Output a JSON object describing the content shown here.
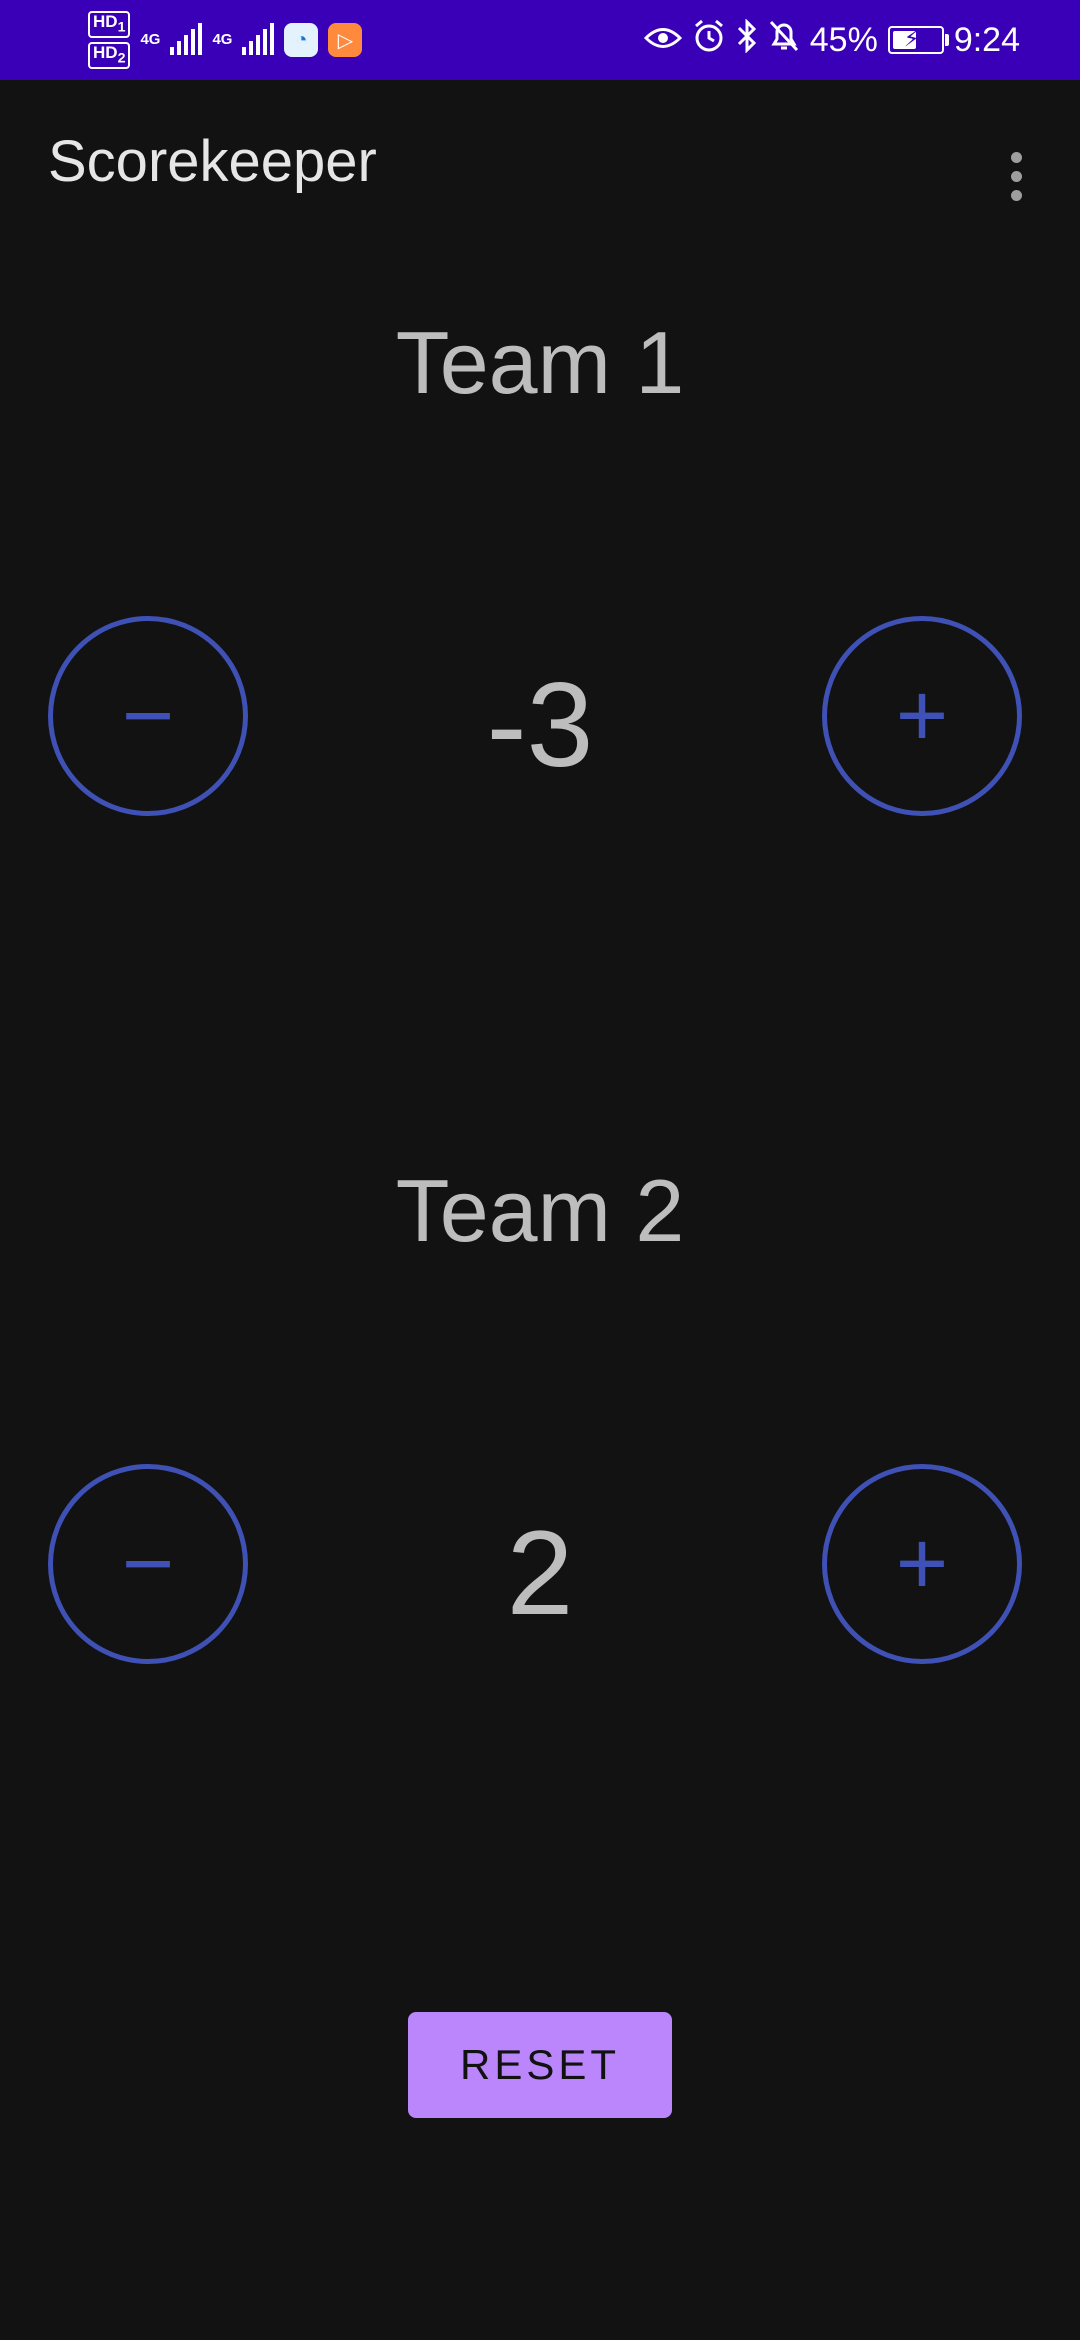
{
  "status_bar": {
    "sim1": "HD",
    "sim1_num": "1",
    "sim2": "HD",
    "sim2_num": "2",
    "net1": "4G",
    "net2": "4G",
    "battery_percent": "45%",
    "time": "9:24",
    "icons": [
      "eye-icon",
      "alarm-icon",
      "bluetooth-icon",
      "bell-off-icon",
      "battery-icon"
    ]
  },
  "app_bar": {
    "title": "Scorekeeper",
    "overflow_icon": "more-vert-icon"
  },
  "teams": [
    {
      "name": "Team 1",
      "score": "-3",
      "minus": "−",
      "plus": "+"
    },
    {
      "name": "Team 2",
      "score": "2",
      "minus": "−",
      "plus": "+"
    }
  ],
  "reset_label": "RESET",
  "colors": {
    "status_bar": "#3a00b7",
    "background": "#121212",
    "accent": "#3f51b5",
    "reset_button": "#bb86fc"
  }
}
